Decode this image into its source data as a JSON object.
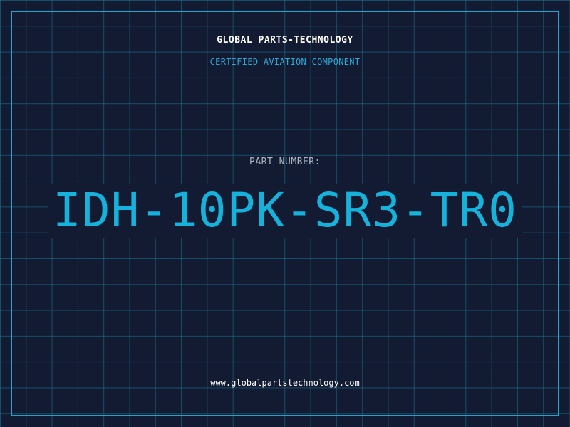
{
  "label": {
    "company": "GLOBAL PARTS-TECHNOLOGY",
    "tagline": "CERTIFIED AVIATION COMPONENT",
    "part_number_label": "PART NUMBER:",
    "part_number": "IDH-10PK-SR3-TR0",
    "website": "www.globalpartstechnology.com"
  },
  "colors": {
    "background": "#121b31",
    "grid": "#1e7896",
    "frame": "#18a8d2",
    "accent": "#15b2dc",
    "text": "#ffffff",
    "muted": "#a9b3c2"
  }
}
